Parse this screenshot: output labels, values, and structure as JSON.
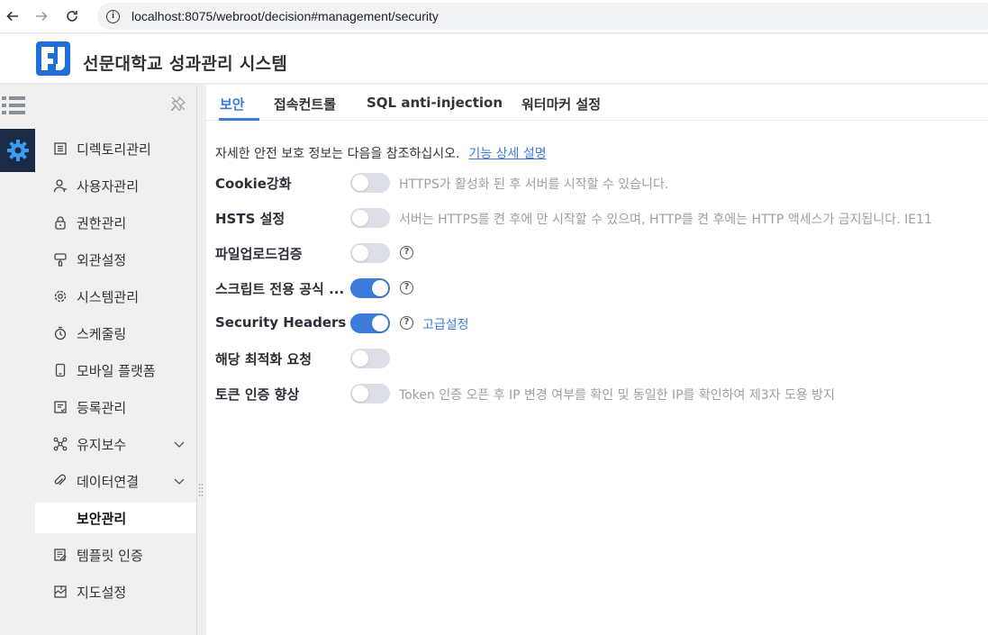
{
  "browser": {
    "url": "localhost:8075/webroot/decision#management/security"
  },
  "app": {
    "title": "선문대학교 성과관리 시스템",
    "brand_color": "#1f6fd9",
    "rail_active_bg": "#1b2b46"
  },
  "sidebar": {
    "items": [
      {
        "label": "디렉토리관리",
        "icon": "directory-icon"
      },
      {
        "label": "사용자관리",
        "icon": "user-icon"
      },
      {
        "label": "권한관리",
        "icon": "lock-icon"
      },
      {
        "label": "외관설정",
        "icon": "brush-icon"
      },
      {
        "label": "시스템관리",
        "icon": "gear-icon"
      },
      {
        "label": "스케줄링",
        "icon": "clock-icon"
      },
      {
        "label": "모바일 플랫폼",
        "icon": "mobile-icon"
      },
      {
        "label": "등록관리",
        "icon": "register-icon"
      },
      {
        "label": "유지보수",
        "icon": "network-icon",
        "expandable": true
      },
      {
        "label": "데이터연결",
        "icon": "link-icon",
        "expandable": true
      },
      {
        "label": "보안관리",
        "icon": "",
        "active": true
      },
      {
        "label": "템플릿 인증",
        "icon": "template-icon"
      },
      {
        "label": "지도설정",
        "icon": "map-icon"
      }
    ]
  },
  "tabs": [
    {
      "label": "보안",
      "active": true
    },
    {
      "label": "접속컨트롤"
    },
    {
      "label": "SQL anti-injection"
    },
    {
      "label": "워터마커 설정"
    }
  ],
  "main": {
    "intro": "자세한 안전 보호 정보는 다음을 참조하십시오.",
    "intro_link": "기능 상세 설명",
    "settings": [
      {
        "label": "Cookie강화",
        "on": false,
        "hint": "HTTPS가 활성화 된 후 서버를 시작할 수 있습니다."
      },
      {
        "label": "HSTS 설정",
        "on": false,
        "hint": "서버는 HTTPS를 켠 후에 만 시작할 수 있으며, HTTP를 켠 후에는 HTTP 액세스가 금지됩니다. IE11"
      },
      {
        "label": "파일업로드검증",
        "on": false,
        "help": true
      },
      {
        "label": "스크립트 전용 공식 ...",
        "on": true,
        "help": true
      },
      {
        "label": "Security Headers",
        "on": true,
        "help": true,
        "advanced": "고급설정"
      },
      {
        "label": "해당 최적화 요청",
        "on": false
      },
      {
        "label": "토큰 인증 향상",
        "on": false,
        "hint": "Token 인증 오픈 후 IP 변경 여부를 확인 및 동일한 IP를 확인하여 제3자 도용 방지"
      }
    ],
    "help_glyph": "?"
  },
  "colors": {
    "accent": "#3b7cdb",
    "toggle_off": "#dcdfe6",
    "hint": "#9a9fa8"
  }
}
